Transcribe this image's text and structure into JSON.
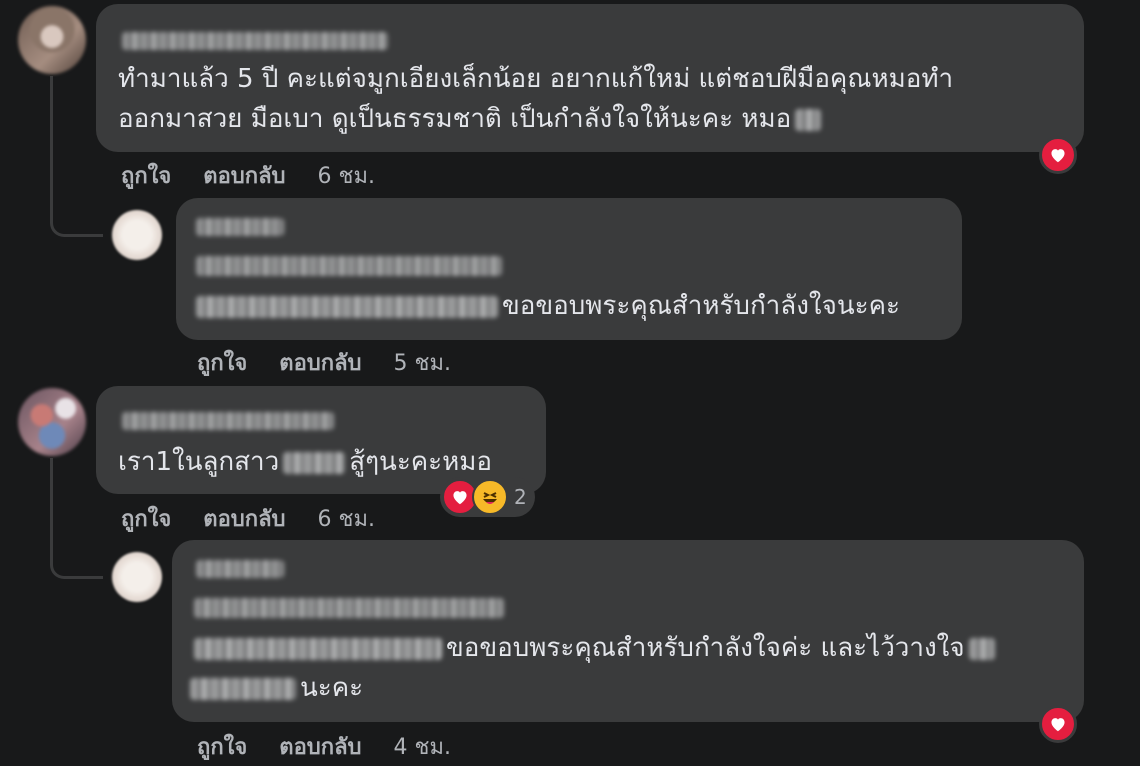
{
  "comments": [
    {
      "text_line1": "ทำมาแล้ว 5 ปี คะแต่จมูกเอียงเล็กน้อย อยากแก้ใหม่ แต่ชอบฝีมือคุณหมอทำ",
      "text_line2": "ออกมาสวย มือเบา ดูเป็นธรรมชาติ เป็นกำลังใจให้นะคะ หมอ",
      "like_label": "ถูกใจ",
      "reply_label": "ตอบกลับ",
      "time": "6 ชม.",
      "reactions": [
        "heart-icon"
      ]
    },
    {
      "text_line3_suffix": "ขอขอบพระคุณสำหรับกำลังใจนะคะ",
      "like_label": "ถูกใจ",
      "reply_label": "ตอบกลับ",
      "time": "5 ชม."
    },
    {
      "text_before": "เรา1ในลูกสาว",
      "text_after": "สู้ๆนะคะหมอ",
      "like_label": "ถูกใจ",
      "reply_label": "ตอบกลับ",
      "time": "6 ชม.",
      "reactions": [
        "heart-icon",
        "haha-icon"
      ],
      "reaction_count": "2"
    },
    {
      "text_line3_suffix": "ขอขอบพระคุณสำหรับกำลังใจค่ะ และไว้วางใจ",
      "text_line4_suffix": "นะคะ",
      "like_label": "ถูกใจ",
      "reply_label": "ตอบกลับ",
      "time": "4 ชม.",
      "reactions": [
        "heart-icon"
      ]
    }
  ],
  "colors": {
    "background": "#18191a",
    "bubble": "#3a3b3c",
    "text": "#e4e6eb",
    "meta": "#b0b3b8",
    "heart": "#e41e3f",
    "haha": "#f7b928"
  }
}
